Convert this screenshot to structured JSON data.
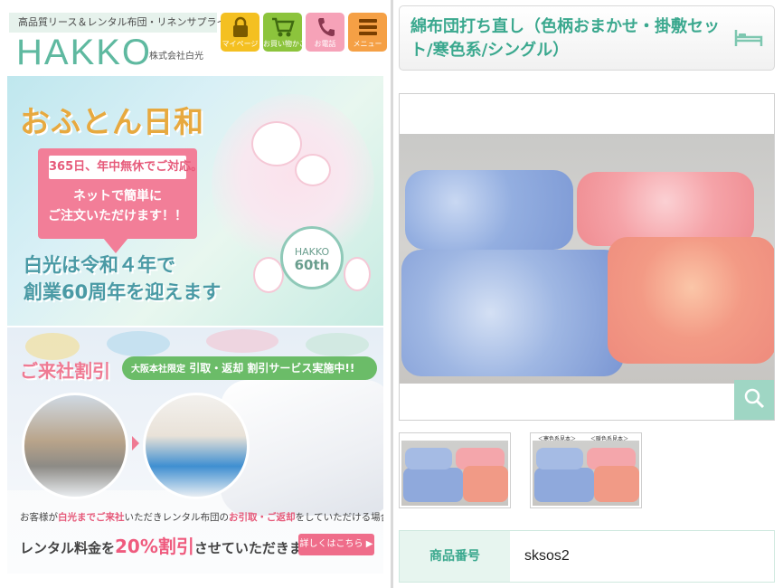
{
  "header": {
    "tagline": "高品質リース＆レンタル布団・リネンサプライ",
    "logo": "HAKKO",
    "company": "株式会社白光",
    "nav": [
      {
        "label": "マイページ",
        "icon": "lock-icon",
        "color": "#f4c021"
      },
      {
        "label": "お買い物かご",
        "icon": "cart-icon",
        "color": "#8cc43c"
      },
      {
        "label": "お電話",
        "icon": "phone-icon",
        "color": "#f6a2b8"
      },
      {
        "label": "メニュー",
        "icon": "menu-icon",
        "color": "#f5a045"
      }
    ]
  },
  "banner1": {
    "title": "おふとん日和",
    "tag": "365日、年中無休でご対応。",
    "order_line1": "ネットで簡単に",
    "order_line2": "ご注文いただけます！！",
    "badge_top": "HAKKO",
    "badge_bottom": "60th",
    "anniv_line1": "白光は令和４年で",
    "anniv_line2": "創業60周年を迎えます"
  },
  "banner2": {
    "title": "ご来社割引",
    "pill_small": "大阪本社限定",
    "pill_text": "引取・返却 割引サービス実施中!!",
    "desc_a": "お客様が",
    "desc_b": "白光までご来社",
    "desc_c": "いただきレンタル布団の",
    "desc_d": "お引取・ご返却",
    "desc_e": "をしていただける場合、",
    "offer_a": "レンタル料金を",
    "offer_b": "20%割引",
    "offer_c": "させていただきます。",
    "button": "詳しくはこちら"
  },
  "product": {
    "title": "綿布団打ち直し（色柄おまかせ・掛敷セット/寒色系/シングル）",
    "thumb2_left_label": "＜寒色系見本＞",
    "thumb2_right_label": "＜暖色系見本＞",
    "spec_key": "商品番号",
    "spec_value": "sksos2"
  },
  "colors": {
    "brand_green": "#5fb9a0",
    "title_green": "#3aa88e",
    "pink": "#ef7a93"
  }
}
